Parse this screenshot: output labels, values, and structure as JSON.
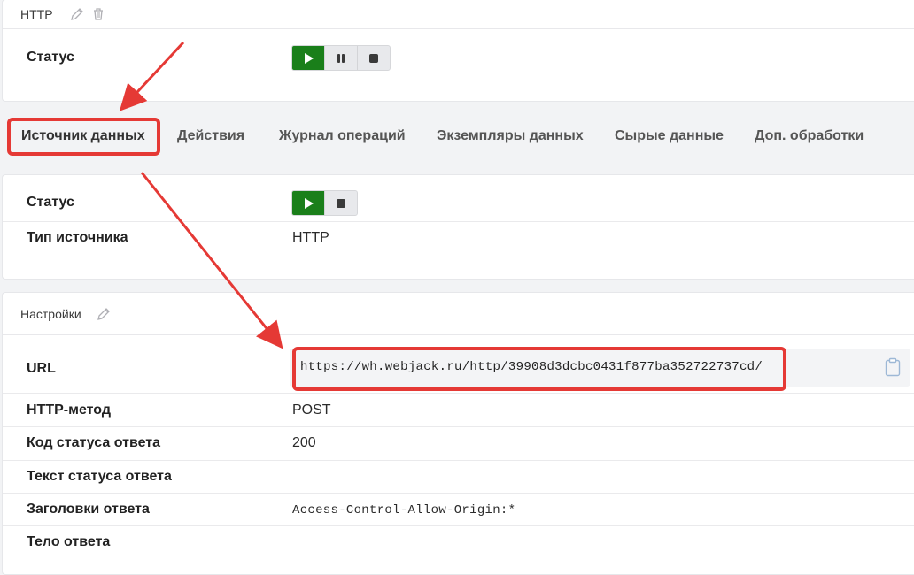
{
  "top_card": {
    "title": "HTTP",
    "status_label": "Статус"
  },
  "tabs": [
    {
      "label": "Источник данных",
      "active": true
    },
    {
      "label": "Действия"
    },
    {
      "label": "Журнал операций"
    },
    {
      "label": "Экземпляры данных"
    },
    {
      "label": "Сырые данные"
    },
    {
      "label": "Доп. обработки"
    }
  ],
  "source_card": {
    "status_label": "Статус",
    "type_label": "Тип источника",
    "type_value": "HTTP"
  },
  "settings_card": {
    "title": "Настройки",
    "url_label": "URL",
    "url_value": "https://wh.webjack.ru/http/39908d3dcbc0431f877ba352722737cd/",
    "method_label": "HTTP-метод",
    "method_value": "POST",
    "status_code_label": "Код статуса ответа",
    "status_code_value": "200",
    "status_text_label": "Текст статуса ответа",
    "status_text_value": "",
    "headers_label": "Заголовки ответа",
    "headers_value": "Access-Control-Allow-Origin:*",
    "body_label": "Тело ответа",
    "body_value": ""
  },
  "colors": {
    "play_button": "#1a7f1a",
    "highlight": "#e53935"
  },
  "icons": [
    "pencil-icon",
    "trash-icon",
    "play-icon",
    "pause-icon",
    "stop-icon",
    "clipboard-icon"
  ]
}
